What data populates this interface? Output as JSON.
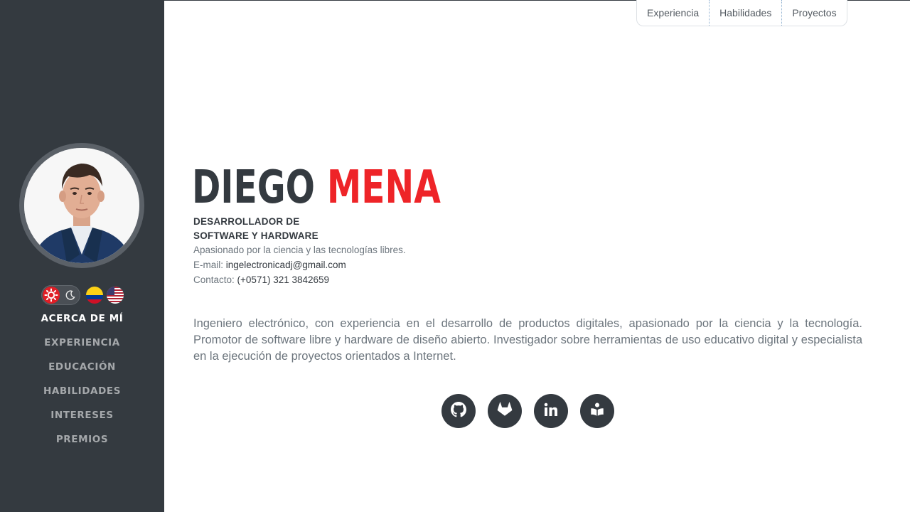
{
  "sidebar": {
    "profile_photo_alt": "Diego Mena",
    "theme_toggle": {
      "light_icon": "sun-icon",
      "dark_icon": "moon-icon"
    },
    "languages": [
      {
        "name": "Español",
        "icon": "colombia-flag-icon"
      },
      {
        "name": "English",
        "icon": "usa-flag-icon"
      }
    ],
    "nav": [
      {
        "label": "ACERCA DE MÍ",
        "active": true
      },
      {
        "label": "EXPERIENCIA"
      },
      {
        "label": "EDUCACIÓN"
      },
      {
        "label": "HABILIDADES"
      },
      {
        "label": "INTERESES"
      },
      {
        "label": "PREMIOS"
      }
    ],
    "colors": {
      "background": "#343a40",
      "accent": "#e01e26"
    }
  },
  "topnav": {
    "items": [
      {
        "label": "Experiencia"
      },
      {
        "label": "Habilidades"
      },
      {
        "label": "Proyectos"
      }
    ]
  },
  "about": {
    "first_name": "DIEGO",
    "last_name": "MENA",
    "role_line1": "DESARROLLADOR DE",
    "role_line2": "SOFTWARE Y HARDWARE",
    "tagline": "Apasionado por la ciencia y las tecnologías libres.",
    "email_label": "E-mail: ",
    "email": "ingelectronicadj@gmail.com",
    "contact_label": "Contacto: ",
    "phone": "(+0571) 321 3842659",
    "bio": "Ingeniero electrónico, con experiencia en el desarrollo de productos digitales, apasionado por la ciencia y la tecnología. Promotor de software libre y hardware de diseño abierto. Investigador sobre herramientas de uso educativo digital y especialista en la ejecución de proyectos orientados a Internet.",
    "colors": {
      "name_primary": "#343a40",
      "name_accent": "#ee2428"
    }
  },
  "social": [
    {
      "name": "GitHub",
      "icon": "github-icon"
    },
    {
      "name": "GitLab",
      "icon": "gitlab-icon"
    },
    {
      "name": "LinkedIn",
      "icon": "linkedin-icon"
    },
    {
      "name": "Blog",
      "icon": "book-reader-icon"
    }
  ]
}
